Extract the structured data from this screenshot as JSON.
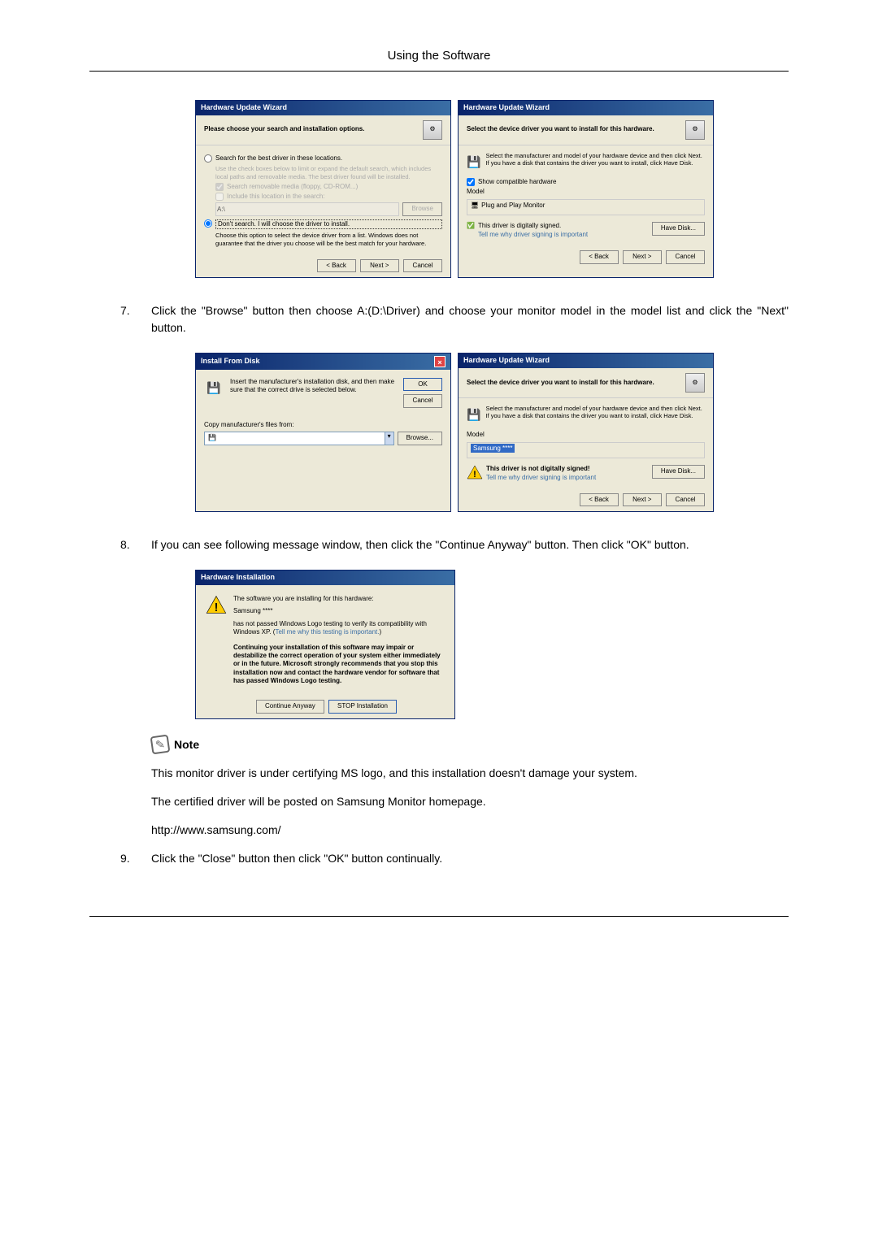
{
  "header_title": "Using the Software",
  "dialog1": {
    "title": "Hardware Update Wizard",
    "heading": "Please choose your search and installation options.",
    "radio1": "Search for the best driver in these locations.",
    "radio1_desc": "Use the check boxes below to limit or expand the default search, which includes local paths and removable media. The best driver found will be installed.",
    "check1": "Search removable media (floppy, CD-ROM...)",
    "check2": "Include this location in the search:",
    "path": "A:\\",
    "browse": "Browse",
    "radio2": "Don't search. I will choose the driver to install.",
    "radio2_desc": "Choose this option to select the device driver from a list. Windows does not guarantee that the driver you choose will be the best match for your hardware.",
    "back": "< Back",
    "next": "Next >",
    "cancel": "Cancel"
  },
  "dialog2": {
    "title": "Hardware Update Wizard",
    "heading": "Select the device driver you want to install for this hardware.",
    "desc": "Select the manufacturer and model of your hardware device and then click Next. If you have a disk that contains the driver you want to install, click Have Disk.",
    "show_compat": "Show compatible hardware",
    "model_label": "Model",
    "model_item": "Plug and Play Monitor",
    "signed": "This driver is digitally signed.",
    "signed_link": "Tell me why driver signing is important",
    "have_disk": "Have Disk...",
    "back": "< Back",
    "next": "Next >",
    "cancel": "Cancel"
  },
  "step7_num": "7.",
  "step7_text": "Click the \"Browse\" button then choose A:(D:\\Driver) and choose your monitor model in the model list and click the \"Next\" button.",
  "dialog3": {
    "title": "Install From Disk",
    "desc": "Insert the manufacturer's installation disk, and then make sure that the correct drive is selected below.",
    "ok": "OK",
    "cancel": "Cancel",
    "copy_label": "Copy manufacturer's files from:",
    "browse": "Browse..."
  },
  "dialog4": {
    "title": "Hardware Update Wizard",
    "heading": "Select the device driver you want to install for this hardware.",
    "desc": "Select the manufacturer and model of your hardware device and then click Next. If you have a disk that contains the driver you want to install, click Have Disk.",
    "model_label": "Model",
    "model_item": "Samsung ****",
    "not_signed": "This driver is not digitally signed!",
    "signed_link": "Tell me why driver signing is important",
    "have_disk": "Have Disk...",
    "back": "< Back",
    "next": "Next >",
    "cancel": "Cancel"
  },
  "step8_num": "8.",
  "step8_text": "If you can see following message window, then click the \"Continue Anyway\" button. Then click \"OK\" button.",
  "dialog5": {
    "title": "Hardware Installation",
    "line1": "The software you are installing for this hardware:",
    "line2": "Samsung ****",
    "line3": "has not passed Windows Logo testing to verify its compatibility with Windows XP. (",
    "line3_link": "Tell me why this testing is important.",
    "line3_end": ")",
    "bold": "Continuing your installation of this software may impair or destabilize the correct operation of your system either immediately or in the future. Microsoft strongly recommends that you stop this installation now and contact the hardware vendor for software that has passed Windows Logo testing.",
    "continue": "Continue Anyway",
    "stop": "STOP Installation"
  },
  "note_label": "Note",
  "note_p1": "This monitor driver is under certifying MS logo, and this installation doesn't damage your system.",
  "note_p2": "The certified driver will be posted on Samsung Monitor homepage.",
  "note_url": "http://www.samsung.com/",
  "step9_num": "9.",
  "step9_text": "Click the \"Close\" button then click \"OK\" button continually."
}
